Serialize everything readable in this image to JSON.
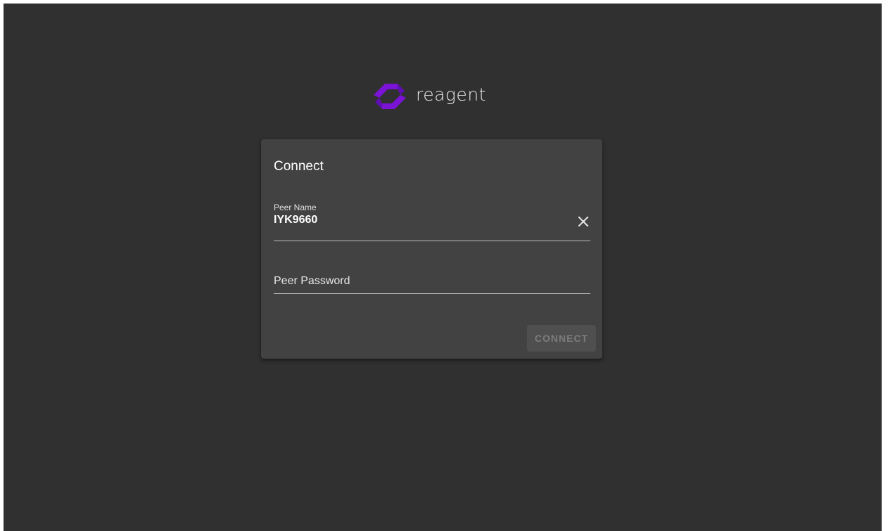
{
  "brand": {
    "name": "reagent",
    "logo_icon": "reagent-chain-logo-icon",
    "accent_color": "#7a13d6"
  },
  "dialog": {
    "title": "Connect",
    "peer_name": {
      "label": "Peer Name",
      "value": "IYK9660",
      "clear_icon": "close-icon"
    },
    "peer_password": {
      "placeholder": "Peer Password",
      "value": ""
    },
    "connect_button": {
      "label": "CONNECT",
      "disabled": true
    }
  },
  "colors": {
    "background": "#303030",
    "card": "#424242"
  }
}
